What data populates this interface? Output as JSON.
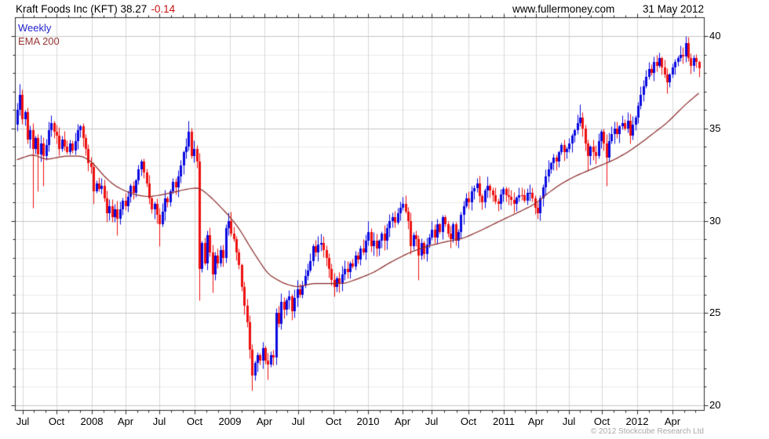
{
  "header": {
    "title_main": "Kraft Foods Inc (KFT) 38.27",
    "title_change": "-0.14",
    "website": "www.fullermoney.com",
    "date": "31 May 2012"
  },
  "legend": {
    "series": "Weekly",
    "overlay": "EMA 200"
  },
  "footer": {
    "copyright": "© 2012 Stockcube Research Ltd"
  },
  "chart_data": {
    "type": "candlestick",
    "interval": "weekly",
    "instrument": "Kraft Foods Inc (KFT)",
    "last_price": 38.27,
    "change": -0.14,
    "weeks": 259,
    "y_axis": {
      "side": "right",
      "min": 19.8,
      "max": 41.0,
      "ticks": [
        20,
        25,
        30,
        35,
        40
      ],
      "minor_step": 1
    },
    "x_axis": {
      "ticks": [
        {
          "label": "Jul",
          "week": 2.1
        },
        {
          "label": "Oct",
          "week": 15.1
        },
        {
          "label": "2008",
          "week": 28.5
        },
        {
          "label": "Apr",
          "week": 41.2
        },
        {
          "label": "Jul",
          "week": 54.0
        },
        {
          "label": "Oct",
          "week": 67.1
        },
        {
          "label": "2009",
          "week": 80.7
        },
        {
          "label": "Apr",
          "week": 93.8
        },
        {
          "label": "Jul",
          "week": 106.5
        },
        {
          "label": "Oct",
          "week": 119.8
        },
        {
          "label": "2010",
          "week": 133.0
        },
        {
          "label": "Apr",
          "week": 145.8
        },
        {
          "label": "Jul",
          "week": 157.0
        },
        {
          "label": "Oct",
          "week": 170.9
        },
        {
          "label": "2011",
          "week": 184.3
        },
        {
          "label": "Apr",
          "week": 196.4
        },
        {
          "label": "Jul",
          "week": 208.9
        },
        {
          "label": "Oct",
          "week": 221.4
        },
        {
          "label": "2012",
          "week": 234.7
        },
        {
          "label": "Apr",
          "week": 248.1
        }
      ]
    },
    "close_anchors": [
      [
        0,
        36.0
      ],
      [
        1,
        36.8
      ],
      [
        2,
        35.5
      ],
      [
        3,
        35.9
      ],
      [
        4,
        34.4
      ],
      [
        5,
        34.9
      ],
      [
        6,
        33.9
      ],
      [
        7,
        34.5
      ],
      [
        8,
        33.6
      ],
      [
        9,
        34.2
      ],
      [
        10,
        33.5
      ],
      [
        11,
        34.1
      ],
      [
        12,
        34.9
      ],
      [
        13,
        35.3
      ],
      [
        14,
        34.8
      ],
      [
        15,
        34.6
      ],
      [
        16,
        33.9
      ],
      [
        17,
        34.4
      ],
      [
        18,
        34.0
      ],
      [
        19,
        33.7
      ],
      [
        20,
        34.2
      ],
      [
        21,
        33.8
      ],
      [
        22,
        34.3
      ],
      [
        23,
        34.9
      ],
      [
        24,
        35.1
      ],
      [
        25,
        34.5
      ],
      [
        26,
        33.9
      ],
      [
        27,
        33.1
      ],
      [
        28,
        32.9
      ],
      [
        29,
        31.6
      ],
      [
        30,
        32.0
      ],
      [
        31,
        31.7
      ],
      [
        32,
        31.9
      ],
      [
        33,
        31.2
      ],
      [
        34,
        30.4
      ],
      [
        35,
        30.8
      ],
      [
        36,
        30.2
      ],
      [
        37,
        30.6
      ],
      [
        38,
        30.1
      ],
      [
        39,
        30.6
      ],
      [
        40,
        31.1
      ],
      [
        41,
        30.8
      ],
      [
        42,
        31.3
      ],
      [
        43,
        31.9
      ],
      [
        44,
        31.5
      ],
      [
        45,
        32.2
      ],
      [
        46,
        32.8
      ],
      [
        47,
        33.2
      ],
      [
        48,
        32.6
      ],
      [
        49,
        32.0
      ],
      [
        50,
        31.2
      ],
      [
        51,
        30.6
      ],
      [
        52,
        30.9
      ],
      [
        53,
        30.3
      ],
      [
        54,
        29.8
      ],
      [
        55,
        30.5
      ],
      [
        56,
        31.2
      ],
      [
        57,
        31.0
      ],
      [
        58,
        31.6
      ],
      [
        59,
        32.1
      ],
      [
        60,
        31.8
      ],
      [
        61,
        32.4
      ],
      [
        62,
        33.0
      ],
      [
        63,
        33.7
      ],
      [
        64,
        34.0
      ],
      [
        65,
        34.8
      ],
      [
        66,
        33.5
      ],
      [
        67,
        33.9
      ],
      [
        68,
        33.2
      ],
      [
        69,
        27.4
      ],
      [
        70,
        28.8
      ],
      [
        71,
        27.7
      ],
      [
        72,
        29.2
      ],
      [
        73,
        28.3
      ],
      [
        74,
        27.1
      ],
      [
        75,
        28.1
      ],
      [
        76,
        27.7
      ],
      [
        77,
        28.4
      ],
      [
        78,
        28.0
      ],
      [
        79,
        29.6
      ],
      [
        80,
        30.0
      ],
      [
        81,
        29.3
      ],
      [
        82,
        29.0
      ],
      [
        83,
        28.3
      ],
      [
        84,
        27.6
      ],
      [
        85,
        26.4
      ],
      [
        86,
        25.4
      ],
      [
        87,
        24.5
      ],
      [
        88,
        23.0
      ],
      [
        89,
        21.6
      ],
      [
        90,
        22.3
      ],
      [
        91,
        22.7
      ],
      [
        92,
        22.4
      ],
      [
        93,
        23.1
      ],
      [
        94,
        22.4
      ],
      [
        95,
        22.2
      ],
      [
        96,
        22.7
      ],
      [
        97,
        22.6
      ],
      [
        98,
        25.0
      ],
      [
        99,
        24.4
      ],
      [
        100,
        25.6
      ],
      [
        101,
        25.2
      ],
      [
        102,
        25.7
      ],
      [
        103,
        25.9
      ],
      [
        104,
        25.1
      ],
      [
        105,
        25.8
      ],
      [
        106,
        26.3
      ],
      [
        107,
        26.0
      ],
      [
        108,
        26.5
      ],
      [
        109,
        27.0
      ],
      [
        110,
        27.3
      ],
      [
        111,
        27.8
      ],
      [
        112,
        28.6
      ],
      [
        113,
        28.3
      ],
      [
        114,
        28.7
      ],
      [
        115,
        28.8
      ],
      [
        116,
        28.4
      ],
      [
        117,
        28.0
      ],
      [
        118,
        27.4
      ],
      [
        119,
        26.8
      ],
      [
        120,
        26.4
      ],
      [
        121,
        26.9
      ],
      [
        122,
        26.6
      ],
      [
        123,
        27.1
      ],
      [
        124,
        27.4
      ],
      [
        125,
        27.2
      ],
      [
        126,
        27.7
      ],
      [
        127,
        27.5
      ],
      [
        128,
        28.1
      ],
      [
        129,
        27.9
      ],
      [
        130,
        28.5
      ],
      [
        131,
        28.3
      ],
      [
        132,
        28.9
      ],
      [
        133,
        29.4
      ],
      [
        134,
        28.6
      ],
      [
        135,
        28.9
      ],
      [
        136,
        28.5
      ],
      [
        137,
        28.9
      ],
      [
        138,
        29.3
      ],
      [
        139,
        28.9
      ],
      [
        140,
        29.6
      ],
      [
        141,
        30.0
      ],
      [
        142,
        30.2
      ],
      [
        143,
        29.9
      ],
      [
        144,
        30.4
      ],
      [
        145,
        30.7
      ],
      [
        146,
        30.9
      ],
      [
        147,
        30.5
      ],
      [
        148,
        30.0
      ],
      [
        149,
        28.6
      ],
      [
        150,
        29.2
      ],
      [
        151,
        29.0
      ],
      [
        152,
        28.1
      ],
      [
        153,
        28.8
      ],
      [
        154,
        28.2
      ],
      [
        155,
        28.7
      ],
      [
        156,
        29.1
      ],
      [
        157,
        29.5
      ],
      [
        158,
        29.1
      ],
      [
        159,
        29.8
      ],
      [
        160,
        29.4
      ],
      [
        161,
        30.2
      ],
      [
        162,
        29.8
      ],
      [
        163,
        29.3
      ],
      [
        164,
        29.0
      ],
      [
        165,
        29.8
      ],
      [
        166,
        28.9
      ],
      [
        167,
        29.4
      ],
      [
        168,
        30.3
      ],
      [
        169,
        30.8
      ],
      [
        170,
        31.2
      ],
      [
        171,
        31.0
      ],
      [
        172,
        31.6
      ],
      [
        174,
        32.0
      ],
      [
        176,
        31.0
      ],
      [
        178,
        31.9
      ],
      [
        180,
        31.4
      ],
      [
        182,
        30.9
      ],
      [
        184,
        31.7
      ],
      [
        186,
        31.3
      ],
      [
        188,
        30.9
      ],
      [
        190,
        31.4
      ],
      [
        192,
        31.1
      ],
      [
        194,
        31.5
      ],
      [
        196,
        30.7
      ],
      [
        197,
        30.4
      ],
      [
        198,
        31.2
      ],
      [
        199,
        31.8
      ],
      [
        200,
        32.4
      ],
      [
        201,
        32.8
      ],
      [
        202,
        33.1
      ],
      [
        203,
        33.4
      ],
      [
        204,
        33.2
      ],
      [
        205,
        33.7
      ],
      [
        206,
        34.1
      ],
      [
        207,
        33.7
      ],
      [
        208,
        33.9
      ],
      [
        209,
        34.2
      ],
      [
        210,
        34.6
      ],
      [
        211,
        34.9
      ],
      [
        212,
        35.3
      ],
      [
        213,
        35.6
      ],
      [
        214,
        35.0
      ],
      [
        215,
        34.2
      ],
      [
        216,
        33.5
      ],
      [
        217,
        34.0
      ],
      [
        218,
        33.7
      ],
      [
        219,
        33.5
      ],
      [
        220,
        34.3
      ],
      [
        221,
        34.8
      ],
      [
        222,
        34.2
      ],
      [
        223,
        33.4
      ],
      [
        224,
        34.3
      ],
      [
        225,
        34.7
      ],
      [
        226,
        35.0
      ],
      [
        227,
        34.7
      ],
      [
        228,
        35.1
      ],
      [
        229,
        35.3
      ],
      [
        230,
        35.0
      ],
      [
        231,
        35.4
      ],
      [
        232,
        34.6
      ],
      [
        233,
        35.2
      ],
      [
        234,
        35.6
      ],
      [
        235,
        36.2
      ],
      [
        236,
        36.8
      ],
      [
        237,
        37.3
      ],
      [
        238,
        37.8
      ],
      [
        239,
        38.2
      ],
      [
        240,
        38.0
      ],
      [
        241,
        38.6
      ],
      [
        242,
        38.4
      ],
      [
        243,
        38.8
      ],
      [
        244,
        38.3
      ],
      [
        245,
        37.9
      ],
      [
        246,
        37.5
      ],
      [
        247,
        37.9
      ],
      [
        248,
        38.3
      ],
      [
        249,
        38.6
      ],
      [
        250,
        38.8
      ],
      [
        251,
        39.0
      ],
      [
        252,
        38.9
      ],
      [
        253,
        39.6
      ],
      [
        254,
        38.8
      ],
      [
        255,
        38.4
      ],
      [
        256,
        38.8
      ],
      [
        257,
        38.6
      ],
      [
        258,
        38.27
      ]
    ],
    "wick_overrides": {
      "1": {
        "high": 37.4
      },
      "6": {
        "low": 30.7
      },
      "8": {
        "low": 31.6
      },
      "10": {
        "low": 31.9
      },
      "29": {
        "low": 30.9
      },
      "38": {
        "low": 29.2
      },
      "54": {
        "low": 28.6
      },
      "65": {
        "high": 35.4
      },
      "69": {
        "low": 25.7
      },
      "74": {
        "low": 26.1
      },
      "89": {
        "low": 20.8
      },
      "95": {
        "low": 21.4
      },
      "133": {
        "high": 30.0
      },
      "152": {
        "low": 26.8
      },
      "197": {
        "low": 30.1
      },
      "213": {
        "high": 36.3
      },
      "216": {
        "low": 32.7
      },
      "223": {
        "low": 31.9
      },
      "232": {
        "low": 34.2
      },
      "243": {
        "high": 39.1
      },
      "246": {
        "low": 36.9
      },
      "253": {
        "high": 40.0
      }
    },
    "ema_anchors": [
      [
        0,
        33.3
      ],
      [
        6,
        33.6
      ],
      [
        11,
        33.3
      ],
      [
        18,
        33.5
      ],
      [
        25,
        33.5
      ],
      [
        29,
        33.1
      ],
      [
        33,
        32.4
      ],
      [
        37,
        31.9
      ],
      [
        41,
        31.6
      ],
      [
        45,
        31.4
      ],
      [
        49,
        31.3
      ],
      [
        53,
        31.35
      ],
      [
        58,
        31.5
      ],
      [
        64,
        31.7
      ],
      [
        69,
        31.8
      ],
      [
        74,
        31.2
      ],
      [
        80,
        30.3
      ],
      [
        84,
        29.6
      ],
      [
        89,
        28.4
      ],
      [
        95,
        27.1
      ],
      [
        101,
        26.6
      ],
      [
        106,
        26.4
      ],
      [
        112,
        26.6
      ],
      [
        124,
        26.6
      ],
      [
        130,
        26.9
      ],
      [
        135,
        27.2
      ],
      [
        142,
        27.8
      ],
      [
        149,
        28.3
      ],
      [
        155,
        28.6
      ],
      [
        162,
        28.85
      ],
      [
        169,
        29.05
      ],
      [
        176,
        29.5
      ],
      [
        183,
        30.0
      ],
      [
        189,
        30.4
      ],
      [
        196,
        30.9
      ],
      [
        201,
        31.5
      ],
      [
        206,
        32.0
      ],
      [
        211,
        32.4
      ],
      [
        216,
        32.7
      ],
      [
        221,
        33.0
      ],
      [
        226,
        33.3
      ],
      [
        231,
        33.7
      ],
      [
        236,
        34.2
      ],
      [
        241,
        34.75
      ],
      [
        246,
        35.3
      ],
      [
        253,
        36.3
      ],
      [
        258,
        36.9
      ]
    ],
    "colors": {
      "up": "#0a0ae0",
      "down": "#ee1010",
      "ema": "#8b2828",
      "grid_minor": "#ececec",
      "grid_major": "#c6c6c6",
      "grid_vertical": "#d9d9d9",
      "axis": "#2a2a2a",
      "title_change": "#cc1111",
      "legend_weekly": "#2222cc",
      "legend_ema": "#993333",
      "copyright": "#a8a8a8"
    }
  }
}
